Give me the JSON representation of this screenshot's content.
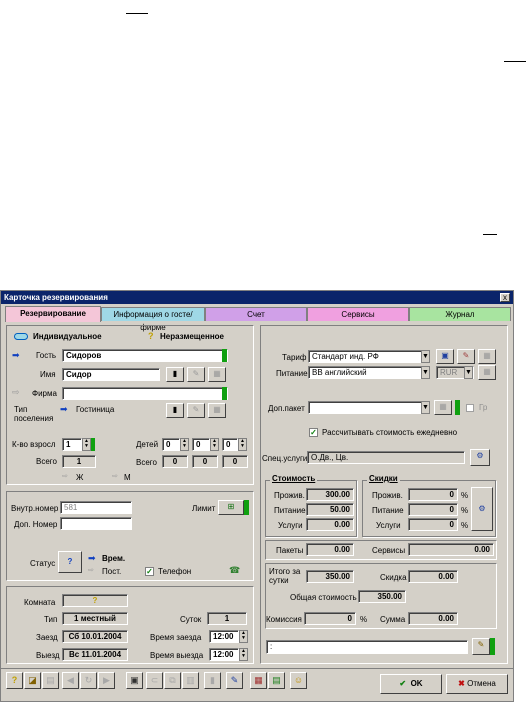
{
  "window": {
    "title": "Карточка резервирования",
    "close": "x"
  },
  "tabs": [
    {
      "label": "Резервирование",
      "color": "#f4c6d8"
    },
    {
      "label": "Информация о госте/фирме",
      "color": "#9fd8e6"
    },
    {
      "label": "Счет",
      "color": "#d0a0e8"
    },
    {
      "label": "Сервисы",
      "color": "#f0a0e0"
    },
    {
      "label": "Журнал",
      "color": "#a8e4a0"
    }
  ],
  "guest": {
    "individual": "Индивидуальное",
    "unplaced": "Неразмещенное",
    "guest_label": "Гость",
    "guest_value": "Сидоров",
    "name_label": "Имя",
    "name_value": "Сидор",
    "firm_label": "Фирма",
    "firm_value": "",
    "type_label": "Тип поселения",
    "type_value": "Гостиница",
    "adults_label": "К-во взросл",
    "adults_value": "1",
    "children_label": "Детей",
    "children_values": [
      "0",
      "0",
      "0"
    ],
    "total_label": "Всего",
    "total_adults": "1",
    "total_children": [
      "0",
      "0",
      "0"
    ],
    "female": "Ж",
    "male": "М"
  },
  "internal": {
    "inner_label": "Внутр.номер",
    "inner_value": "581",
    "limit_label": "Лимит",
    "extra_label": "Доп. Номер",
    "extra_value": "",
    "status_label": "Статус",
    "status_temp": "Врем.",
    "status_perm": "Пост.",
    "phone_label": "Телефон"
  },
  "room": {
    "room_label": "Комната",
    "type_label": "Тип",
    "type_value": "1 местный",
    "nights_label": "Суток",
    "nights_value": "1",
    "arrive_label": "Заезд",
    "arrive_value": "Сб 10.01.2004",
    "arrive_time_label": "Время заезда",
    "arrive_time": "12:00",
    "depart_label": "Выезд",
    "depart_value": "Вс 11.01.2004",
    "depart_time_label": "Время выезда",
    "depart_time": "12:00"
  },
  "tariff": {
    "tariff_label": "Тариф",
    "tariff_value": "Стандарт инд. РФ",
    "meal_label": "Питание",
    "meal_value": "ВВ английский",
    "currency": "RUR",
    "package_label": "Доп.пакет",
    "package_value": "",
    "gr_label": "Гр",
    "daily_label": "Рассчитывать стоимость ежедневно",
    "special_label": "Спец.услуги",
    "special_value": "О.Дв., Цв."
  },
  "cost": {
    "title": "Стоимость",
    "living_label": "Прожив.",
    "living_value": "300.00",
    "meal_label": "Питание",
    "meal_value": "50.00",
    "services_label": "Услуги",
    "services_value": "0.00"
  },
  "discounts": {
    "title": "Скидки",
    "living_label": "Прожив.",
    "living_value": "0",
    "meal_label": "Питание",
    "meal_value": "0",
    "services_label": "Услуги",
    "services_value": "0",
    "percent": "%"
  },
  "summary": {
    "packages_label": "Пакеты",
    "packages_value": "0.00",
    "services_label": "Сервисы",
    "services_value": "0.00",
    "per_day_label": "Итого за сутки",
    "per_day_value": "350.00",
    "discount_label": "Скидка",
    "discount_value": "0.00",
    "total_label": "Общая стоимость",
    "total_value": "350.00",
    "commission_label": "Комиссия",
    "commission_value": "0",
    "percent": "%",
    "sum_label": "Сумма",
    "sum_value": "0.00"
  },
  "note": {
    "value": ":"
  },
  "footer": {
    "ok": "OK",
    "cancel": "Отмена"
  }
}
